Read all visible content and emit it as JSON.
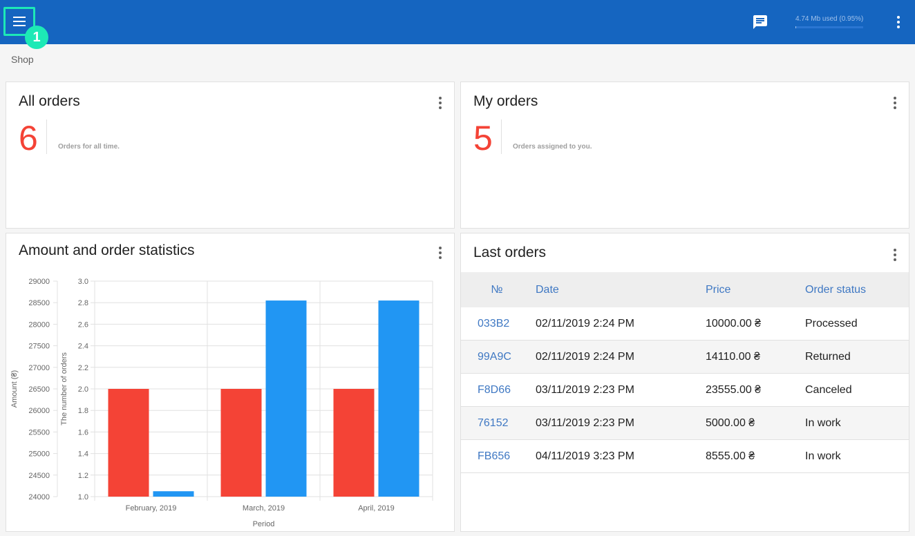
{
  "topbar": {
    "badge": "1",
    "storage_text": "4.74 Mb used (0.95%)",
    "storage_fraction": 0.0095
  },
  "icons": {
    "menu": "menu-icon",
    "chat": "chat-icon",
    "more": "more-vert-icon"
  },
  "colors": {
    "primary": "#1565c0",
    "accent": "#1de9b6",
    "amount_series": "#f44336",
    "orders_series": "#2196f3",
    "link": "#3f78c3"
  },
  "breadcrumb": "Shop",
  "all_orders": {
    "title": "All orders",
    "value": "6",
    "caption": "Orders for all time."
  },
  "my_orders": {
    "title": "My orders",
    "value": "5",
    "caption": "Orders assigned to you."
  },
  "stats": {
    "title": "Amount and order statistics"
  },
  "chart_data": {
    "type": "bar",
    "title": "",
    "xlabel": "Period",
    "categories": [
      "February, 2019",
      "March, 2019",
      "April, 2019"
    ],
    "series": [
      {
        "axis": "left",
        "values": [
          26500,
          26500,
          26500
        ]
      },
      {
        "axis": "right",
        "values": [
          1.05,
          2.82,
          2.82
        ]
      }
    ],
    "y_left": {
      "label": "Amount (₴)",
      "range": [
        24000,
        29000
      ],
      "ticks": [
        "29000",
        "28500",
        "28000",
        "27500",
        "27000",
        "26500",
        "26000",
        "25500",
        "25000",
        "24500",
        "24000"
      ]
    },
    "y_right": {
      "label": "The number of orders",
      "range": [
        1.0,
        3.0
      ],
      "ticks": [
        "3.0",
        "2.8",
        "2.6",
        "2.4",
        "2.2",
        "2.0",
        "1.8",
        "1.6",
        "1.4",
        "1.2",
        "1.0"
      ]
    },
    "grid": true
  },
  "last_orders": {
    "title": "Last orders",
    "headers": [
      "№",
      "Date",
      "Price",
      "Order status"
    ],
    "rows": [
      {
        "id": "033B2",
        "date": "02/11/2019 2:24 PM",
        "price": "10000.00 ₴",
        "status": "Processed"
      },
      {
        "id": "99A9C",
        "date": "02/11/2019 2:24 PM",
        "price": "14110.00 ₴",
        "status": "Returned"
      },
      {
        "id": "F8D66",
        "date": "03/11/2019 2:23 PM",
        "price": "23555.00 ₴",
        "status": "Canceled"
      },
      {
        "id": "76152",
        "date": "03/11/2019 2:23 PM",
        "price": "5000.00 ₴",
        "status": "In work"
      },
      {
        "id": "FB656",
        "date": "04/11/2019 3:23 PM",
        "price": "8555.00 ₴",
        "status": "In work"
      }
    ]
  }
}
